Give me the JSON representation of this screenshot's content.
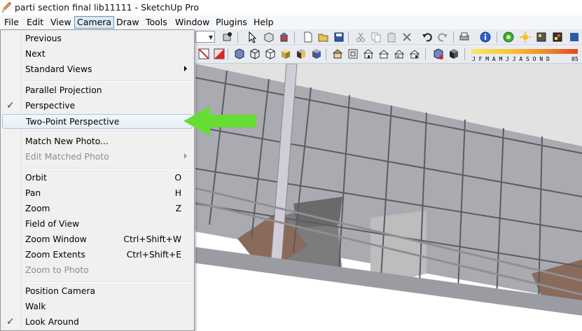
{
  "window": {
    "title": "parti section final lib11111 - SketchUp Pro",
    "icon": "sketchup-pencil-icon"
  },
  "menubar": {
    "items": [
      {
        "label": "File"
      },
      {
        "label": "Edit"
      },
      {
        "label": "View"
      },
      {
        "label": "Camera",
        "active": true
      },
      {
        "label": "Draw"
      },
      {
        "label": "Tools"
      },
      {
        "label": "Window"
      },
      {
        "label": "Plugins"
      },
      {
        "label": "Help"
      }
    ]
  },
  "toolbar": {
    "shadow_months": "J F M A M J J A S O N D",
    "shadow_time_partial": "05"
  },
  "camera_menu": {
    "items": [
      {
        "label": "Previous"
      },
      {
        "label": "Next"
      },
      {
        "label": "Standard Views",
        "submenu": true
      },
      {
        "label": "Parallel Projection"
      },
      {
        "label": "Perspective",
        "checked": true
      },
      {
        "label": "Two-Point Perspective",
        "highlighted": true
      },
      {
        "label": "Match New Photo..."
      },
      {
        "label": "Edit Matched Photo",
        "disabled": true,
        "submenu": true
      },
      {
        "label": "Orbit",
        "shortcut": "O"
      },
      {
        "label": "Pan",
        "shortcut": "H"
      },
      {
        "label": "Zoom",
        "shortcut": "Z"
      },
      {
        "label": "Field of View"
      },
      {
        "label": "Zoom Window",
        "shortcut": "Ctrl+Shift+W"
      },
      {
        "label": "Zoom Extents",
        "shortcut": "Ctrl+Shift+E"
      },
      {
        "label": "Zoom to Photo",
        "disabled": true
      },
      {
        "label": "Position Camera"
      },
      {
        "label": "Walk"
      },
      {
        "label": "Look Around",
        "checked": true
      }
    ]
  },
  "colors": {
    "annotation_arrow": "#66dd33",
    "menu_highlight_border": "#a8c4e4",
    "toolbar_bg": "#e8ebf0"
  }
}
